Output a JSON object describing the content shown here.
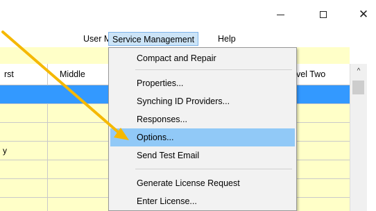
{
  "window": {
    "minimize_label": "—",
    "close_label": "✕"
  },
  "menubar": {
    "items": [
      "User Management",
      "Service Management",
      "Help"
    ]
  },
  "grid": {
    "columns": [
      "rst",
      "Middle",
      "vel Two"
    ],
    "row_fragment": "y"
  },
  "service_menu": {
    "items": [
      "Compact and Repair",
      "Properties...",
      "Synching ID Providers...",
      "Responses...",
      "Options...",
      "Send Test Email",
      "Generate License Request",
      "Enter License..."
    ],
    "hovered": "Options..."
  },
  "scrollbar": {
    "up_arrow": "^"
  },
  "annotation": {
    "arrow_color": "#f5b800"
  }
}
